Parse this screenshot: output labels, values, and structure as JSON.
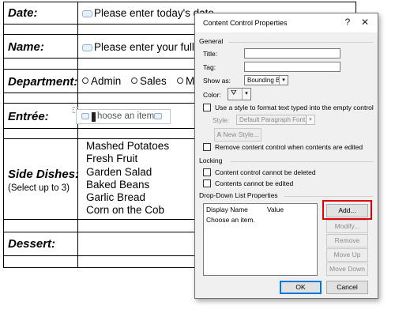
{
  "form": {
    "date_label": "Date:",
    "date_placeholder": "Please enter today's date",
    "name_label": "Name:",
    "name_placeholder": "Please enter your full n",
    "department_label": "Department:",
    "department_options": [
      "Admin",
      "Sales",
      "M"
    ],
    "entree_label": "Entrée:",
    "entree_placeholder": "hoose an item.",
    "side_dishes_label": "Side Dishes:",
    "side_dishes_note": "(Select up to 3)",
    "side_dishes": [
      "Mashed Potatoes",
      "Fresh Fruit",
      "Garden Salad",
      "Baked Beans",
      "Garlic Bread",
      "Corn on the Cob"
    ],
    "dessert_label": "Dessert:"
  },
  "dialog": {
    "title": "Content Control Properties",
    "help_glyph": "?",
    "close_glyph": "✕",
    "general": {
      "heading": "General",
      "title_label": "Title:",
      "title_value": "",
      "tag_label": "Tag:",
      "tag_value": "",
      "show_as_label": "Show as:",
      "show_as_value": "Bounding Box",
      "color_label": "Color:",
      "use_style_label": "Use a style to format text typed into the empty control",
      "style_label": "Style:",
      "style_value": "Default Paragraph Font",
      "new_style_label": "New Style...",
      "remove_control_label": "Remove content control when contents are edited"
    },
    "locking": {
      "heading": "Locking",
      "cannot_delete_label": "Content control cannot be deleted",
      "cannot_edit_label": "Contents cannot be edited"
    },
    "dropdown": {
      "heading": "Drop-Down List Properties",
      "col_display_name": "Display Name",
      "col_value": "Value",
      "items": [
        {
          "display": "Choose an item.",
          "value": ""
        }
      ],
      "add_label": "Add...",
      "modify_label": "Modify...",
      "remove_label": "Remove",
      "move_up_label": "Move Up",
      "move_down_label": "Move Down"
    },
    "ok_label": "OK",
    "cancel_label": "Cancel"
  },
  "colors": {
    "highlight": "#e00000",
    "default_button_border": "#0078d7"
  }
}
